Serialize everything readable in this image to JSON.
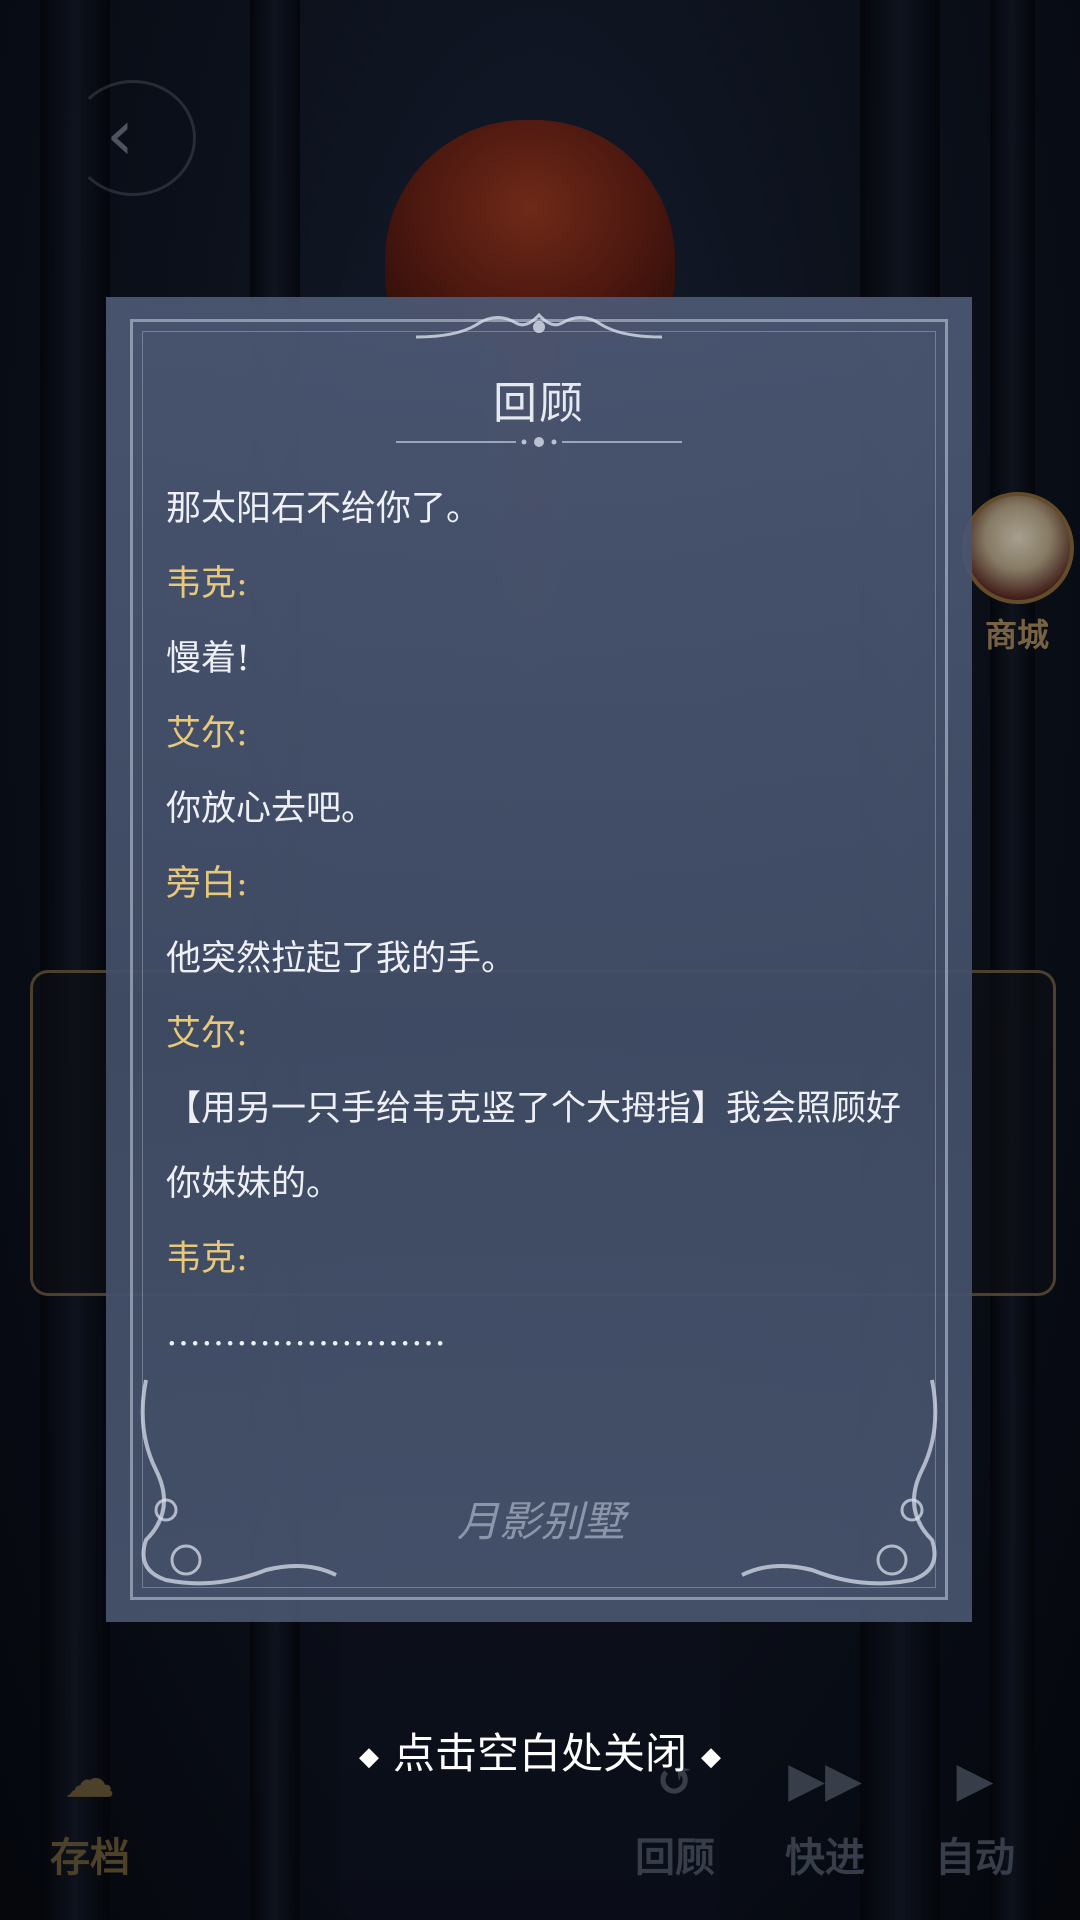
{
  "scene": {
    "shop_label": "商城",
    "controls": {
      "save_label": "存档",
      "review_label": "回顾",
      "fast_forward_label": "快进",
      "auto_label": "自动"
    }
  },
  "review_panel": {
    "title": "回顾",
    "logo_text": "月影别墅",
    "entries": [
      {
        "type": "line",
        "text": "那太阳石不给你了。"
      },
      {
        "type": "speaker",
        "text": "韦克:"
      },
      {
        "type": "line",
        "text": "慢着!"
      },
      {
        "type": "speaker",
        "text": "艾尔:"
      },
      {
        "type": "line",
        "text": "你放心去吧。"
      },
      {
        "type": "speaker",
        "text": "旁白:"
      },
      {
        "type": "line",
        "text": "他突然拉起了我的手。"
      },
      {
        "type": "speaker",
        "text": "艾尔:"
      },
      {
        "type": "line",
        "text": "【用另一只手给韦克竖了个大拇指】我会照顾好你妹妹的。"
      },
      {
        "type": "speaker",
        "text": "韦克:"
      },
      {
        "type": "line",
        "text": "……………………"
      }
    ]
  },
  "close_hint": "点击空白处关闭",
  "colors": {
    "speaker": "#e8c97a",
    "body_text": "#eef0f5",
    "panel_bg": "#4c5874"
  },
  "icons": [
    "back-icon",
    "save-icon",
    "review-icon",
    "fast-forward-icon",
    "play-icon",
    "diamond-icon"
  ]
}
